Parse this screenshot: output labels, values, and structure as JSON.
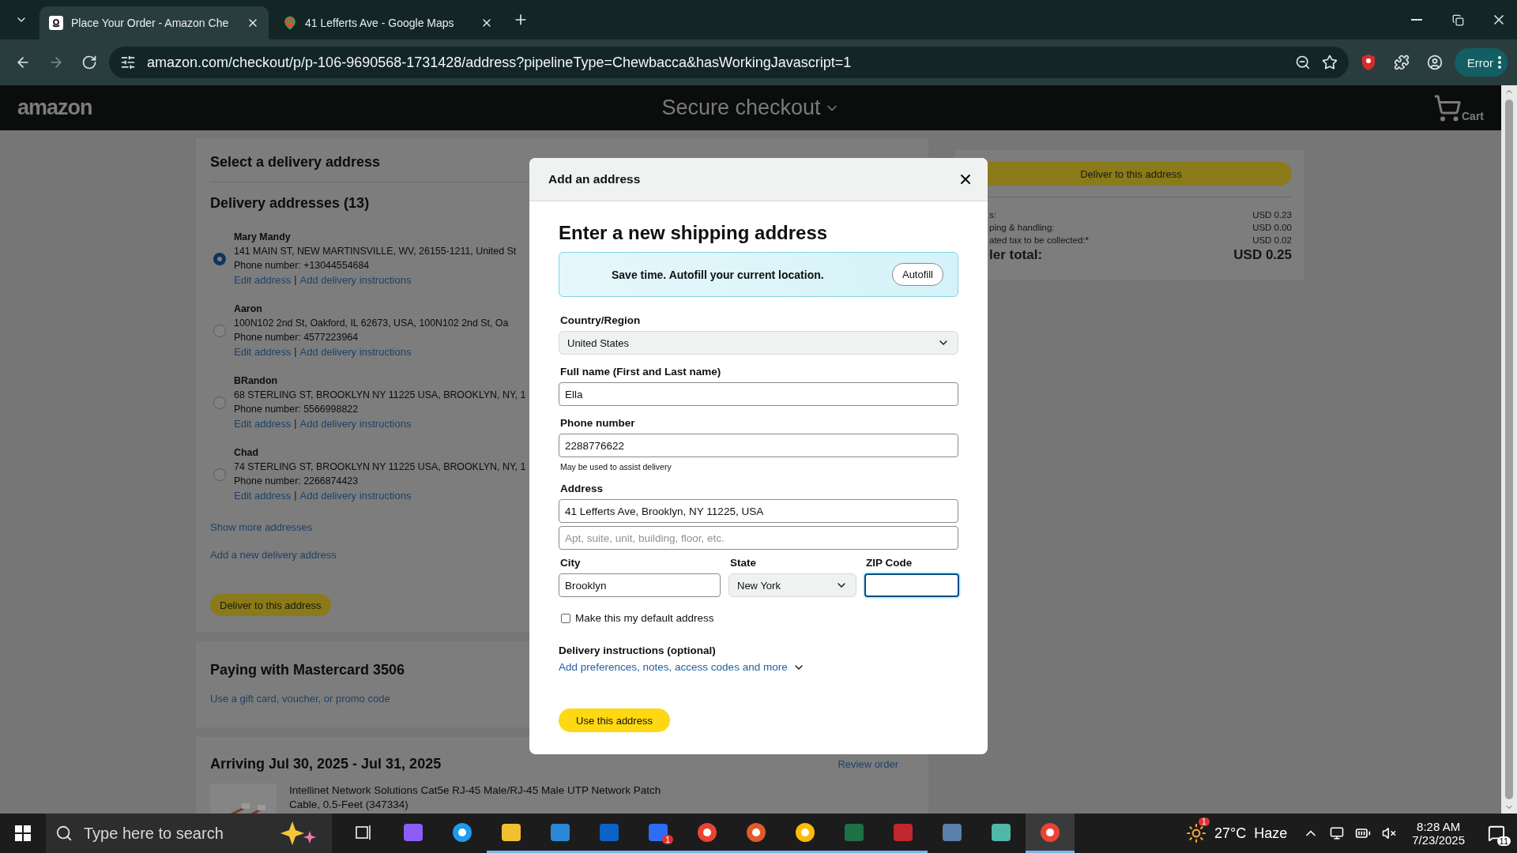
{
  "browser": {
    "tabs": [
      {
        "title": "Place Your Order - Amazon Che",
        "selected": true,
        "kind": "amazon"
      },
      {
        "title": "41 Lefferts Ave - Google Maps",
        "selected": false,
        "kind": "maps"
      }
    ],
    "url": "amazon.com/checkout/p/p-106-9690568-1731428/address?pipelineType=Chewbacca&hasWorkingJavascript=1",
    "profile_button": "Error"
  },
  "header": {
    "logo": "amazon",
    "title": "Secure checkout",
    "cart": "Cart"
  },
  "delivery": {
    "title": "Select a delivery address",
    "heading": "Delivery addresses (13)",
    "addresses": [
      {
        "name": "Mary Mandy",
        "line": "141 MAIN ST, NEW MARTINSVILLE, WV, 26155-1211, United St",
        "phone": "Phone number: +13044554684",
        "selected": true,
        "edit": "Edit address",
        "separator": "|",
        "instructions": "Add delivery instructions"
      },
      {
        "name": "Aaron",
        "line": "100N102 2nd St, Oakford, IL 62673, USA, 100N102 2nd St, Oa",
        "phone": "Phone number: 4577223964",
        "selected": false,
        "edit": "Edit address",
        "separator": "|",
        "instructions": "Add delivery instructions"
      },
      {
        "name": "BRandon",
        "line": "68 STERLING ST, BROOKLYN NY 11225 USA, BROOKLYN, NY, 1",
        "phone": "Phone number: 5566998822",
        "selected": false,
        "edit": "Edit address",
        "separator": "|",
        "instructions": "Add delivery instructions"
      },
      {
        "name": "Chad",
        "line": "74 STERLING ST, BROOKLYN NY 11225 USA, BROOKLYN, NY, 1",
        "phone": "Phone number: 2266874423",
        "selected": false,
        "edit": "Edit address",
        "separator": "|",
        "instructions": "Add delivery instructions"
      }
    ],
    "show_more": "Show more addresses",
    "add_new": "Add a new delivery address",
    "deliver_button": "Deliver to this address"
  },
  "payment": {
    "heading": "Paying with Mastercard 3506",
    "link": "Use a gift card, voucher, or promo code"
  },
  "arriving": {
    "heading": "Arriving Jul 30, 2025 - Jul 31, 2025",
    "review_link": "Review order",
    "item": "Intellinet Network Solutions Cat5e RJ-45 Male/RJ-45 Male UTP Network Patch Cable, 0.5-Feet (347334)"
  },
  "summary": {
    "button": "Deliver to this address",
    "rows": [
      {
        "label": "s:",
        "value": "USD 0.23"
      },
      {
        "label": "ping & handling:",
        "value": "USD 0.00"
      },
      {
        "label": "ated tax to be collected:*",
        "value": "USD 0.02"
      }
    ],
    "total": {
      "label": "ler total:",
      "value": "USD 0.25"
    }
  },
  "modal": {
    "title": "Add an address",
    "heading": "Enter a new shipping address",
    "autofill": {
      "text": "Save time. Autofill your current location.",
      "button": "Autofill"
    },
    "country": {
      "label": "Country/Region",
      "value": "United States"
    },
    "full_name": {
      "label": "Full name (First and Last name)",
      "value": "Ella"
    },
    "phone": {
      "label": "Phone number",
      "value": "2288776622",
      "hint": "May be used to assist delivery"
    },
    "address": {
      "label": "Address",
      "value": "41 Lefferts Ave, Brooklyn, NY 11225, USA",
      "placeholder": "Apt, suite, unit, building, floor, etc."
    },
    "city": {
      "label": "City",
      "value": "Brooklyn"
    },
    "state": {
      "label": "State",
      "value": "New York"
    },
    "zip": {
      "label": "ZIP Code",
      "focused": true
    },
    "default_address": {
      "label": "Make this my default address",
      "checked": false
    },
    "instructions": {
      "label": "Delivery instructions (optional)",
      "link": "Add preferences, notes, access codes and more"
    },
    "submit": "Use this address"
  },
  "taskbar": {
    "search_placeholder": "Type here to search",
    "mail_badge": "1",
    "weather_badge": "1",
    "temperature": "27°C",
    "weather": "Haze",
    "time": "8:28 AM",
    "date": "7/23/2025",
    "notifications": "11"
  }
}
